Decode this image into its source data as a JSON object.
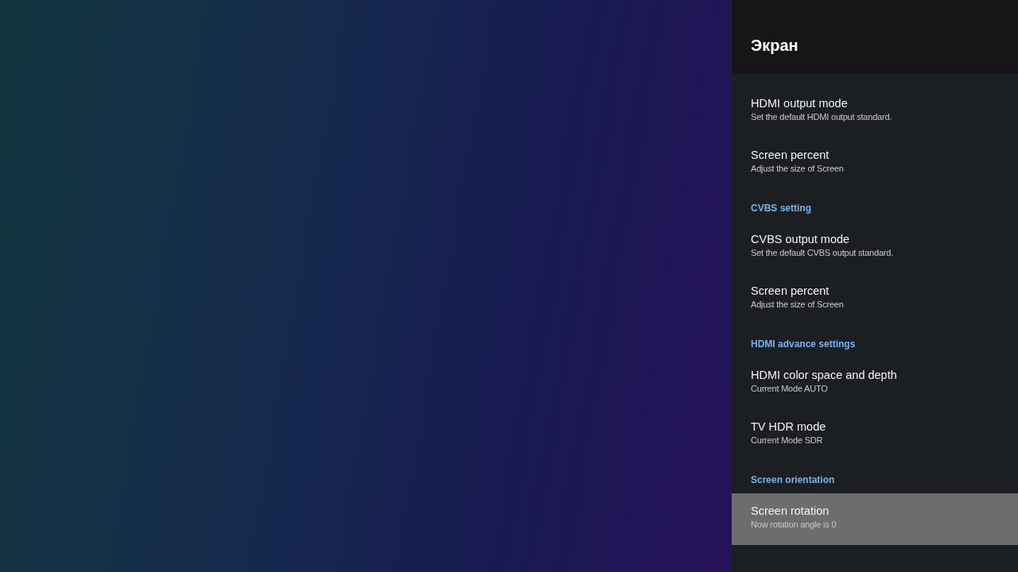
{
  "panel": {
    "title": "Экран",
    "items": [
      {
        "kind": "item",
        "title": "HDMI output mode",
        "subtitle": "Set the default HDMI output standard.",
        "selected": false
      },
      {
        "kind": "item",
        "title": "Screen percent",
        "subtitle": "Adjust the size of Screen",
        "selected": false
      },
      {
        "kind": "header",
        "title": "CVBS setting"
      },
      {
        "kind": "item",
        "title": "CVBS output mode",
        "subtitle": "Set the default CVBS output standard.",
        "selected": false
      },
      {
        "kind": "item",
        "title": "Screen percent",
        "subtitle": "Adjust the size of Screen",
        "selected": false
      },
      {
        "kind": "header",
        "title": "HDMI advance settings"
      },
      {
        "kind": "item",
        "title": "HDMI color space and depth",
        "subtitle": "Current Mode AUTO",
        "selected": false
      },
      {
        "kind": "item",
        "title": "TV HDR mode",
        "subtitle": "Current Mode SDR",
        "selected": false
      },
      {
        "kind": "header",
        "title": "Screen orientation"
      },
      {
        "kind": "item",
        "title": "Screen rotation",
        "subtitle": "Now rotation angle is 0",
        "selected": true
      }
    ]
  }
}
